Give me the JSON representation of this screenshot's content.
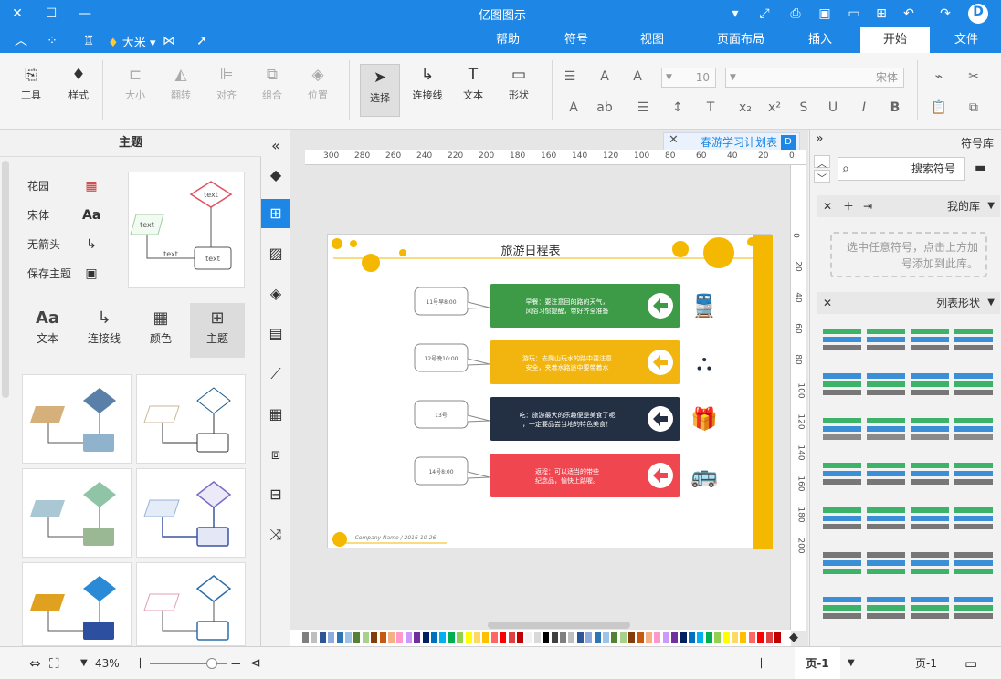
{
  "title": "亿图图示",
  "menu": {
    "items": [
      "文件",
      "开始",
      "插入",
      "页面布局",
      "视图",
      "符号",
      "帮助"
    ],
    "active": "开始",
    "user": "大米"
  },
  "ribbon": {
    "font_name": "宋体",
    "font_size": "10",
    "buttons": {
      "tools": "工具",
      "style": "样式",
      "size": "大小",
      "flip": "翻转",
      "align": "对齐",
      "group": "组合",
      "position": "位置",
      "select": "选择",
      "connector": "连接线",
      "text": "文本",
      "shape": "形状"
    }
  },
  "left_panel": {
    "title": "主题",
    "options": [
      "花园",
      "宋体",
      "无箭头",
      "保存主题"
    ],
    "tabs": [
      "主题",
      "颜色",
      "连接线",
      "文本"
    ],
    "thumb_text": "text"
  },
  "document": {
    "tab_title": "春游学习计划表",
    "page_title": "旅游日程表",
    "footer": "Company Name  /  2016-10-26",
    "ruler_h": [
      "0",
      "20",
      "40",
      "60",
      "80",
      "100",
      "120",
      "140",
      "160",
      "180",
      "200",
      "220",
      "240",
      "260",
      "280",
      "300"
    ],
    "ruler_v": [
      "0",
      "20",
      "40",
      "60",
      "80",
      "100",
      "120",
      "140",
      "160",
      "180",
      "200"
    ],
    "rows": [
      {
        "text": "早餐：要注意回的路的天气，风俗习惯提醒，带好齐全准备",
        "color": "#3d9a47",
        "note": "11号早8:00",
        "icon": "train"
      },
      {
        "text": "游玩：去爬山玩水的路中要注意安全，夹着水路途中要带着水",
        "color": "#f2b50f",
        "note": "12号晚10:00",
        "icon": "binoculars"
      },
      {
        "text": "吃：旅游最大的乐趣便是美食了呢，一定要品尝当地的特色美食！",
        "color": "#233044",
        "note": "13号",
        "icon": "gift"
      },
      {
        "text": "返程：可以适当的带些纪念品，愉快上路喔。",
        "color": "#ef4650",
        "note": "14号8:00",
        "icon": "bus"
      }
    ]
  },
  "right_panel": {
    "title": "符号库",
    "search_placeholder": "搜索符号",
    "my_lib": "我的库",
    "my_lib_hint": "选中任意符号，点击上方加号添加到此库。",
    "list_shapes": "列表形状"
  },
  "status": {
    "page": "页-1",
    "page_tab": "页-1",
    "zoom": "43%"
  },
  "colors": {
    "accent": "#1e87e5",
    "yellow": "#f5b800",
    "green": "#3d9a47",
    "red": "#ef4650",
    "navy": "#233044"
  }
}
